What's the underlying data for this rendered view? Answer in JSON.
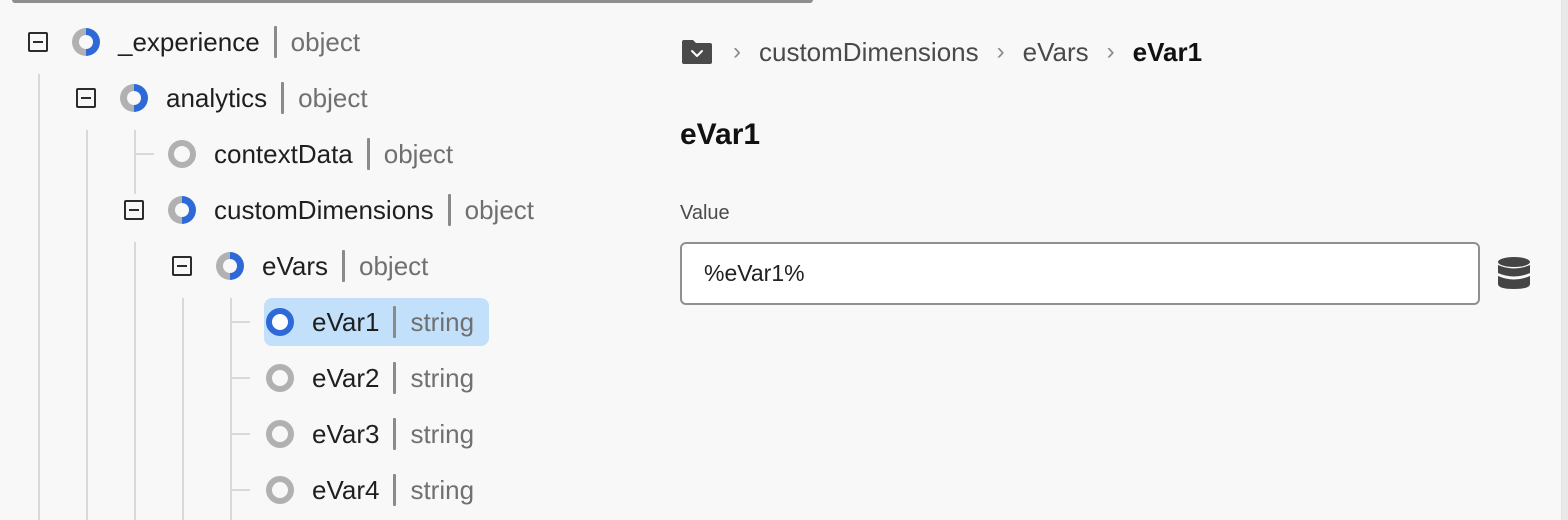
{
  "tree": {
    "nodes": [
      {
        "name": "_experience",
        "type": "object",
        "level": 0,
        "expanded": true,
        "status": "partial"
      },
      {
        "name": "analytics",
        "type": "object",
        "level": 1,
        "expanded": true,
        "status": "partial"
      },
      {
        "name": "contextData",
        "type": "object",
        "level": 2,
        "expanded": false,
        "status": "empty"
      },
      {
        "name": "customDimensions",
        "type": "object",
        "level": 2,
        "expanded": true,
        "status": "partial"
      },
      {
        "name": "eVars",
        "type": "object",
        "level": 3,
        "expanded": true,
        "status": "partial"
      },
      {
        "name": "eVar1",
        "type": "string",
        "level": 4,
        "expanded": false,
        "status": "selected",
        "selected": true
      },
      {
        "name": "eVar2",
        "type": "string",
        "level": 4,
        "expanded": false,
        "status": "empty"
      },
      {
        "name": "eVar3",
        "type": "string",
        "level": 4,
        "expanded": false,
        "status": "empty"
      },
      {
        "name": "eVar4",
        "type": "string",
        "level": 4,
        "expanded": false,
        "status": "empty"
      }
    ]
  },
  "breadcrumb": {
    "root_icon": "folder-icon",
    "items": [
      "customDimensions",
      "eVars",
      "eVar1"
    ],
    "separator": "›"
  },
  "detail": {
    "title": "eVar1",
    "value_label": "Value",
    "value": "%eVar1%",
    "data_element_icon": "database-icon"
  },
  "colors": {
    "accent": "#2d6ad8",
    "selection_bg": "#c3e0fb",
    "ring_grey": "#b1b1b1"
  }
}
